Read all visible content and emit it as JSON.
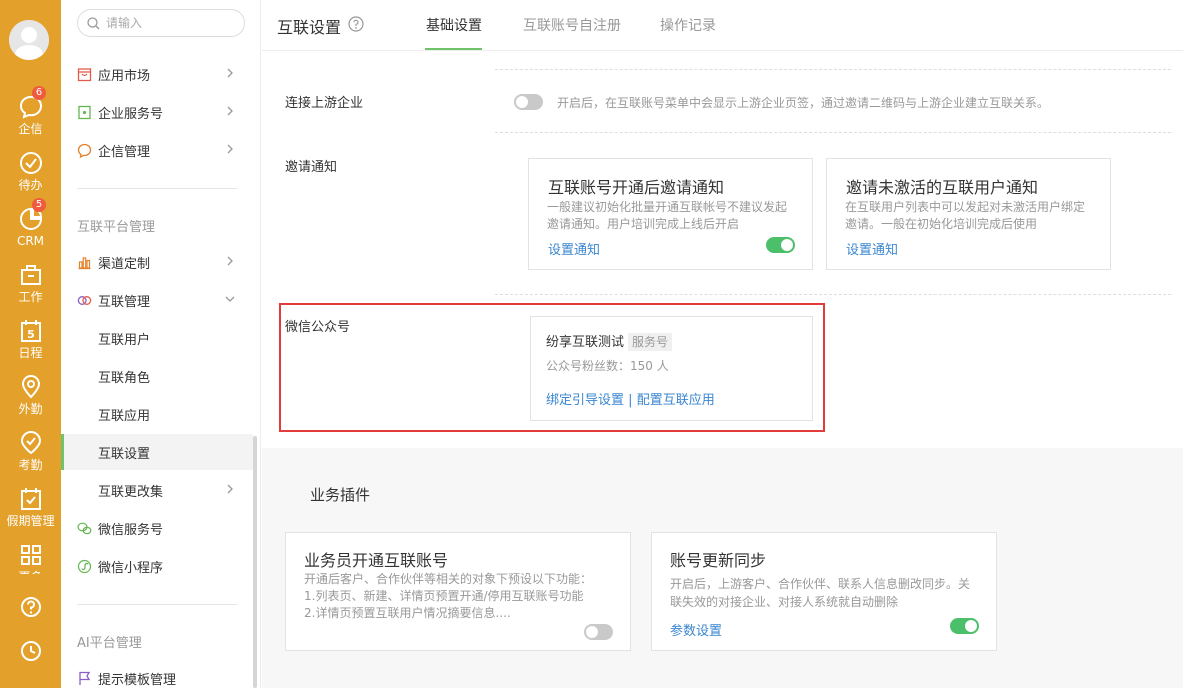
{
  "rail": {
    "items": [
      {
        "label": "企信",
        "icon": "chat-icon",
        "badge": "6"
      },
      {
        "label": "待办",
        "icon": "check-circle-icon",
        "badge": ""
      },
      {
        "label": "CRM",
        "icon": "crm-icon",
        "badge": "5"
      },
      {
        "label": "工作",
        "icon": "briefcase-icon",
        "badge": ""
      },
      {
        "label": "日程",
        "icon": "calendar-icon",
        "badge": ""
      },
      {
        "label": "外勤",
        "icon": "location-icon",
        "badge": ""
      },
      {
        "label": "考勤",
        "icon": "attendance-icon",
        "badge": ""
      },
      {
        "label": "假期管理",
        "icon": "leave-icon",
        "badge": ""
      },
      {
        "label": "更多",
        "icon": "grid-icon",
        "badge": ""
      }
    ],
    "calendar_day": "5"
  },
  "nav": {
    "search_placeholder": "请输入",
    "items_top": [
      {
        "label": "应用市场",
        "icon": "app-market-icon"
      },
      {
        "label": "企业服务号",
        "icon": "service-account-icon"
      },
      {
        "label": "企信管理",
        "icon": "chat-manage-icon"
      }
    ],
    "group1": "互联平台管理",
    "items_group1": [
      {
        "label": "渠道定制",
        "icon": "bar-chart-icon"
      },
      {
        "label": "互联管理",
        "icon": "link-rings-icon"
      }
    ],
    "sub_items": [
      {
        "label": "互联用户"
      },
      {
        "label": "互联角色"
      },
      {
        "label": "互联应用"
      },
      {
        "label": "互联设置"
      },
      {
        "label": "互联更改集"
      }
    ],
    "items_group1_tail": [
      {
        "label": "微信服务号",
        "icon": "wechat-icon"
      },
      {
        "label": "微信小程序",
        "icon": "mini-program-icon"
      }
    ],
    "group2": "AI平台管理",
    "items_group2": [
      {
        "label": "提示模板管理",
        "icon": "flag-icon"
      }
    ]
  },
  "header": {
    "title": "互联设置",
    "tabs": [
      {
        "label": "基础设置"
      },
      {
        "label": "互联账号自注册"
      },
      {
        "label": "操作记录"
      }
    ]
  },
  "basic": {
    "upstream": {
      "label": "连接上游企业",
      "hint": "开启后，在互联账号菜单中会显示上游企业页签，通过邀请二维码与上游企业建立互联关系。"
    },
    "invite": {
      "label": "邀请通知",
      "cards": [
        {
          "title": "互联账号开通后邀请通知",
          "desc_line1": "一般建议初始化批量开通互联帐号不建议发起",
          "desc_line2": "邀请通知。用户培训完成上线后开启",
          "link": "设置通知"
        },
        {
          "title": "邀请未激活的互联用户通知",
          "desc_line1": "在互联用户列表中可以发起对未激活用户绑定",
          "desc_line2": "邀请。一般在初始化培训完成后使用",
          "link": "设置通知"
        }
      ]
    },
    "wechat": {
      "label": "微信公众号",
      "account_name": "纷享互联测试",
      "account_tag": "服务号",
      "fans": "公众号粉丝数：150 人",
      "link_bind": "绑定引导设置",
      "separator": "|",
      "link_config": "配置互联应用"
    }
  },
  "plugins": {
    "title": "业务插件",
    "cards": [
      {
        "title": "业务员开通互联账号",
        "desc_line1": "开通后客户、合作伙伴等相关的对象下预设以下功能：",
        "desc_line2": "1.列表页、新建、详情页预置开通/停用互联账号功能",
        "desc_line3": "2.详情页预置互联用户情况摘要信息...."
      },
      {
        "title": "账号更新同步",
        "desc_line1": "开启后，上游客户、合作伙伴、联系人信息删改同步。关",
        "desc_line2": "联失效的对接企业、对接人系统就自动删除",
        "link": "参数设置"
      }
    ]
  },
  "colors": {
    "rail": "#e3a02a",
    "accent_green": "#70c36a",
    "toggle_on": "#4cbf6a",
    "link_blue": "#3a86d0",
    "highlight_red": "#e23b3b",
    "badge_red": "#f05a3f"
  }
}
